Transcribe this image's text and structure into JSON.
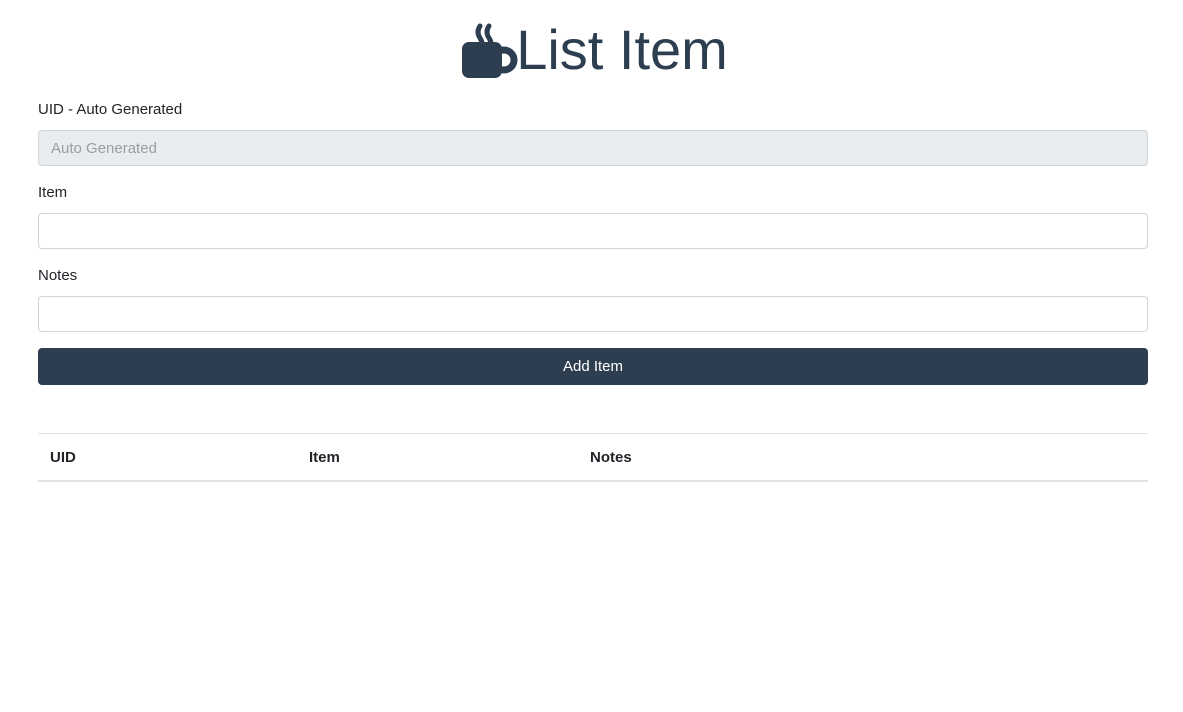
{
  "header": {
    "title": "List Item",
    "icon": "coffee-mug-icon",
    "color": "#2c3e50"
  },
  "form": {
    "uid_label": "UID - Auto Generated",
    "uid_placeholder": "Auto Generated",
    "item_label": "Item",
    "item_value": "",
    "notes_label": "Notes",
    "notes_value": "",
    "submit_label": "Add Item"
  },
  "table": {
    "columns": [
      "UID",
      "Item",
      "Notes"
    ],
    "rows": []
  }
}
